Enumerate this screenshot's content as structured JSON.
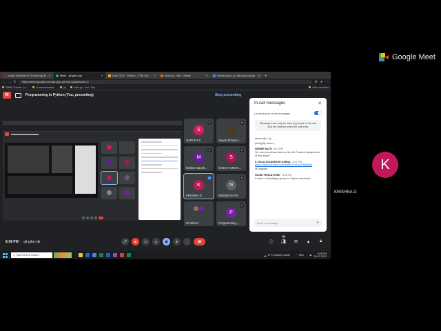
{
  "brand": {
    "name": "Google Meet"
  },
  "right_tile": {
    "initial": "K",
    "name": "KRISHNA G",
    "color": "#c2185b"
  },
  "browser": {
    "tabs": [
      {
        "label": "Indian Institute of Technology M",
        "color": "#9e1f1f"
      },
      {
        "label": "Meet - qit-pjhn-yjk",
        "color": "#34a853"
      },
      {
        "label": "May 2023 - Python - IITM Onl",
        "color": "#f4b400"
      },
      {
        "label": "main.py - fhsl - Replit",
        "color": "#f26207"
      },
      {
        "label": "Introduction_to_Recursion(Upd",
        "color": "#4285f4"
      }
    ],
    "url": "https://meet.google.com/qit-pjhn-yjk?pli=1&authuser=2",
    "bookmarks": [
      "DBMS Tutorial - Le...",
      "cf.adomainaaaa...",
      "(s)",
      "main.py - fhsl - Rep..."
    ],
    "bookmarks_right": "Other favorites"
  },
  "meet": {
    "presenting_text": "Programming in Python (You, presenting)",
    "stop_presenting": "Stop presenting",
    "time": "8:08 PM",
    "separator": "|",
    "meeting_code": "qit-pjhn-yjk",
    "participant_count": "26"
  },
  "tiles": [
    {
      "name": "SARATH S",
      "initial": "S",
      "color": "#d81b60"
    },
    {
      "name": "Sayan Bhowmi...",
      "initial": "",
      "color": "photo"
    },
    {
      "name": "Mohan Mansh...",
      "initial": "M",
      "color": "#6a1b9a"
    },
    {
      "name": "SHIKHA SRIVA...",
      "initial": "S",
      "color": "#ad1457"
    },
    {
      "name": "KRISHNA G",
      "initial": "K",
      "color": "#c2185b"
    },
    {
      "name": "NIDHEE NATH",
      "initial": "N",
      "color": "#5f6368"
    },
    {
      "name": "20 others",
      "initial": "",
      "color": "group"
    },
    {
      "name": "Programming ...",
      "initial": "P",
      "color": "#7b1fa2"
    }
  ],
  "chat": {
    "title": "In-call messages",
    "toggle_label": "Let everyone send messages",
    "notice": "Messages can only be seen by people in the call and are deleted when the call ends",
    "code_lines": [
      "return p(i) * f()",
      "print(p(5)-return)"
    ],
    "messages": [
      {
        "sender": "NIDHEE NATH",
        "time": "8:01 PM",
        "text": "Sir, can you please take up the 6th Practice Assignment of this week?"
      },
      {
        "sender": "D. RAJA JAGADEESH KANNA",
        "time": "8:01 PM",
        "link": "https://www.youtube.com/watch?v=6mcTiMipp4M",
        "text": "@ Vagisha"
      },
      {
        "sender": "FAJRE PENGATTEEE",
        "time": "8:06 PM",
        "text": "Is there a WhatsApp group for Python students?"
      }
    ],
    "input_placeholder": "Send a message"
  },
  "taskbar": {
    "search_placeholder": "Type here to search",
    "weather": "27°C Mostly cloudy",
    "lang": "ENG",
    "clock_time": "8:08 PM",
    "clock_date": "06-07-2023"
  }
}
